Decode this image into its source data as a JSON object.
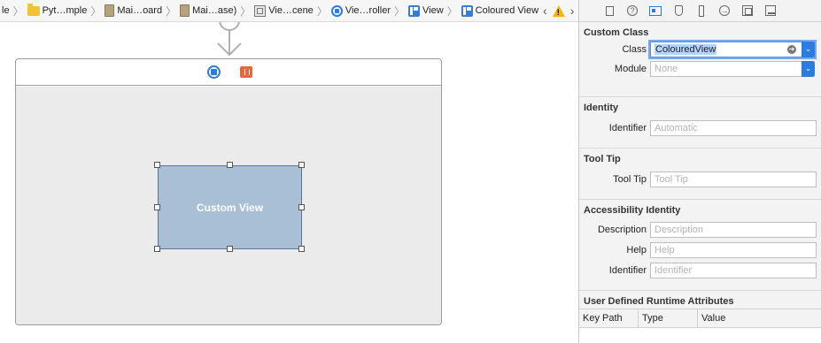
{
  "breadcrumbs": {
    "items": [
      {
        "label": "le",
        "icon": "none"
      },
      {
        "label": "Pyt…mple",
        "icon": "folder-icon"
      },
      {
        "label": "Mai…oard",
        "icon": "storyboard-file-icon"
      },
      {
        "label": "Mai…ase)",
        "icon": "storyboard-file-icon"
      },
      {
        "label": "Vie…cene",
        "icon": "scene-icon"
      },
      {
        "label": "Vie…roller",
        "icon": "view-controller-icon"
      },
      {
        "label": "View",
        "icon": "view-icon"
      },
      {
        "label": "Coloured View",
        "icon": "view-icon"
      }
    ],
    "warning_glyph": "!"
  },
  "canvas": {
    "custom_view_label": "Custom View"
  },
  "inspector": {
    "custom_class": {
      "title": "Custom Class",
      "class_label": "Class",
      "class_value": "ColouredView",
      "module_label": "Module",
      "module_placeholder": "None"
    },
    "identity": {
      "title": "Identity",
      "identifier_label": "Identifier",
      "identifier_placeholder": "Automatic"
    },
    "tool_tip": {
      "title": "Tool Tip",
      "label": "Tool Tip",
      "placeholder": "Tool Tip"
    },
    "accessibility": {
      "title": "Accessibility Identity",
      "description_label": "Description",
      "description_placeholder": "Description",
      "help_label": "Help",
      "help_placeholder": "Help",
      "identifier_label": "Identifier",
      "identifier_placeholder": "Identifier"
    },
    "udra": {
      "title": "User Defined Runtime Attributes",
      "columns": [
        "Key Path",
        "Type",
        "Value"
      ]
    }
  },
  "colors": {
    "accent": "#2a7ce0",
    "custom_view_fill": "#a9bfd6",
    "warning": "#f2b705",
    "object_icon": "#e8663b"
  }
}
